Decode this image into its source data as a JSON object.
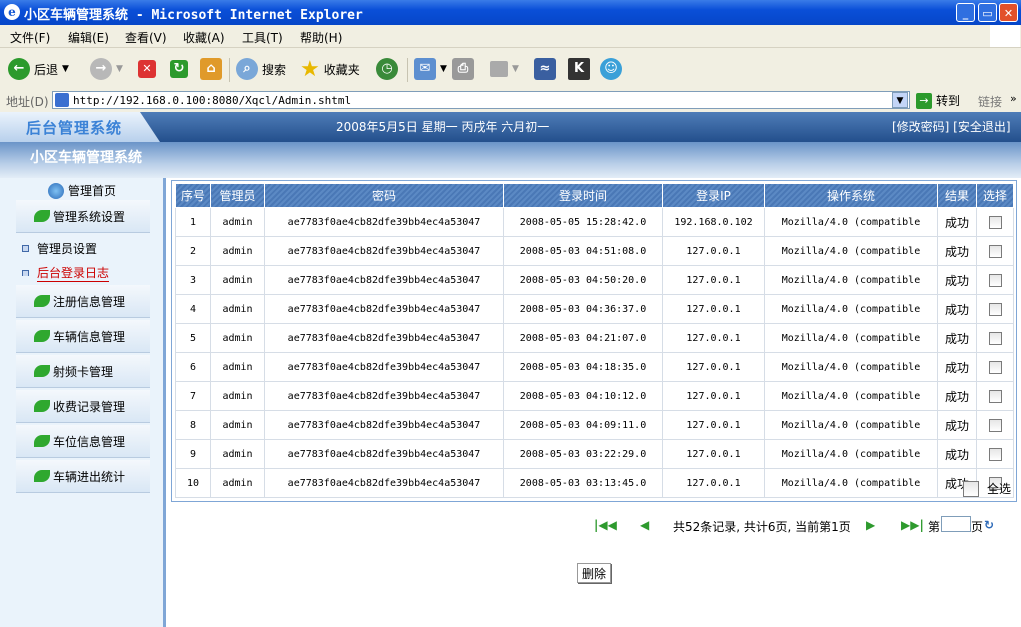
{
  "window": {
    "title": "小区车辆管理系统 - Microsoft Internet Explorer",
    "buttons": {
      "min": "_",
      "max": "▭",
      "close": "✕"
    }
  },
  "menu": [
    "文件(F)",
    "编辑(E)",
    "查看(V)",
    "收藏(A)",
    "工具(T)",
    "帮助(H)"
  ],
  "toolbar": {
    "back": "后退",
    "search": "搜索",
    "favorites": "收藏夹"
  },
  "address": {
    "label": "地址(D)",
    "url": "http://192.168.0.100:8080/Xqcl/Admin.shtml",
    "go": "转到",
    "links": "链接"
  },
  "app": {
    "logo": "后台管理系统",
    "date": "2008年5月5日 星期一 丙戌年 六月初一",
    "links": "[修改密码] [安全退出]",
    "subtitle": "小区车辆管理系统"
  },
  "sidebar": {
    "home": "管理首页",
    "groups": [
      "管理系统设置",
      "注册信息管理",
      "车辆信息管理",
      "射频卡管理",
      "收费记录管理",
      "车位信息管理",
      "车辆进出统计"
    ],
    "links": [
      "管理员设置",
      "后台登录日志"
    ]
  },
  "table": {
    "headers": [
      "序号",
      "管理员",
      "密码",
      "登录时间",
      "登录IP",
      "操作系统",
      "结果",
      "选择"
    ],
    "rows": [
      [
        "1",
        "admin",
        "ae7783f0ae4cb82dfe39bb4ec4a53047",
        "2008-05-05 15:28:42.0",
        "192.168.0.102",
        "Mozilla/4.0 (compatible",
        "成功"
      ],
      [
        "2",
        "admin",
        "ae7783f0ae4cb82dfe39bb4ec4a53047",
        "2008-05-03 04:51:08.0",
        "127.0.0.1",
        "Mozilla/4.0 (compatible",
        "成功"
      ],
      [
        "3",
        "admin",
        "ae7783f0ae4cb82dfe39bb4ec4a53047",
        "2008-05-03 04:50:20.0",
        "127.0.0.1",
        "Mozilla/4.0 (compatible",
        "成功"
      ],
      [
        "4",
        "admin",
        "ae7783f0ae4cb82dfe39bb4ec4a53047",
        "2008-05-03 04:36:37.0",
        "127.0.0.1",
        "Mozilla/4.0 (compatible",
        "成功"
      ],
      [
        "5",
        "admin",
        "ae7783f0ae4cb82dfe39bb4ec4a53047",
        "2008-05-03 04:21:07.0",
        "127.0.0.1",
        "Mozilla/4.0 (compatible",
        "成功"
      ],
      [
        "6",
        "admin",
        "ae7783f0ae4cb82dfe39bb4ec4a53047",
        "2008-05-03 04:18:35.0",
        "127.0.0.1",
        "Mozilla/4.0 (compatible",
        "成功"
      ],
      [
        "7",
        "admin",
        "ae7783f0ae4cb82dfe39bb4ec4a53047",
        "2008-05-03 04:10:12.0",
        "127.0.0.1",
        "Mozilla/4.0 (compatible",
        "成功"
      ],
      [
        "8",
        "admin",
        "ae7783f0ae4cb82dfe39bb4ec4a53047",
        "2008-05-03 04:09:11.0",
        "127.0.0.1",
        "Mozilla/4.0 (compatible",
        "成功"
      ],
      [
        "9",
        "admin",
        "ae7783f0ae4cb82dfe39bb4ec4a53047",
        "2008-05-03 03:22:29.0",
        "127.0.0.1",
        "Mozilla/4.0 (compatible",
        "成功"
      ],
      [
        "10",
        "admin",
        "ae7783f0ae4cb82dfe39bb4ec4a53047",
        "2008-05-03 03:13:45.0",
        "127.0.0.1",
        "Mozilla/4.0 (compatible",
        "成功"
      ]
    ],
    "select_all": "全选"
  },
  "pager": {
    "info": "共52条记录, 共计6页, 当前第1页",
    "page_prefix": "第",
    "page_suffix": "页"
  },
  "actions": {
    "delete": "删除"
  }
}
